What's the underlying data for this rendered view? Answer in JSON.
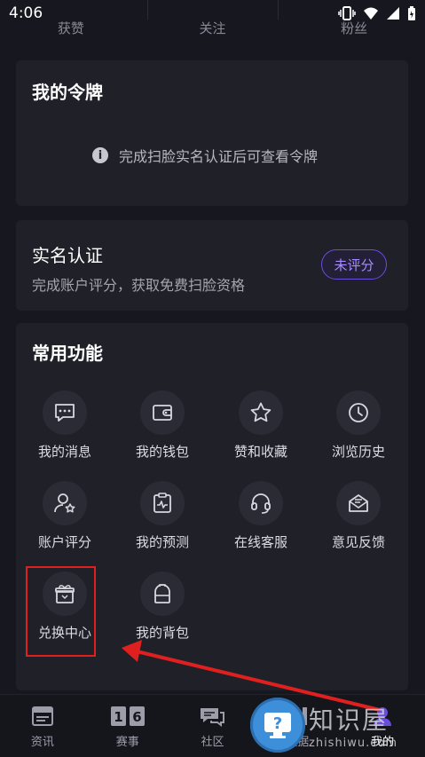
{
  "status": {
    "time": "4:06"
  },
  "stats": [
    {
      "label": "获赞"
    },
    {
      "label": "关注"
    },
    {
      "label": "粉丝"
    }
  ],
  "token_card": {
    "title": "我的令牌",
    "tip": "完成扫脸实名认证后可查看令牌",
    "tip_icon": "info-icon"
  },
  "verify_card": {
    "title": "实名认证",
    "subtitle": "完成账户评分，获取免费扫脸资格",
    "button": "未评分"
  },
  "functions": {
    "title": "常用功能",
    "items": [
      {
        "label": "我的消息",
        "icon": "message-icon"
      },
      {
        "label": "我的钱包",
        "icon": "wallet-icon"
      },
      {
        "label": "赞和收藏",
        "icon": "star-icon"
      },
      {
        "label": "浏览历史",
        "icon": "clock-icon"
      },
      {
        "label": "账户评分",
        "icon": "user-star-icon"
      },
      {
        "label": "我的预测",
        "icon": "clipboard-chart-icon"
      },
      {
        "label": "在线客服",
        "icon": "headset-icon"
      },
      {
        "label": "意见反馈",
        "icon": "feedback-icon"
      },
      {
        "label": "兑换中心",
        "icon": "gift-icon"
      },
      {
        "label": "我的背包",
        "icon": "backpack-icon"
      }
    ]
  },
  "tabbar": [
    {
      "label": "资讯",
      "icon": "news-icon"
    },
    {
      "label": "赛事",
      "icon": "scoreboard-icon",
      "icon_text": "16"
    },
    {
      "label": "社区",
      "icon": "chat-icon"
    },
    {
      "label": "数据",
      "icon": "data-icon"
    },
    {
      "label": "我的",
      "icon": "profile-icon",
      "active": true
    }
  ],
  "watermark": {
    "title": "知识屋",
    "url": "zhishiwu.com",
    "symbol": "?"
  },
  "colors": {
    "accent": "#6b4dde",
    "highlight": "#e0201f",
    "background": "#17171f"
  }
}
